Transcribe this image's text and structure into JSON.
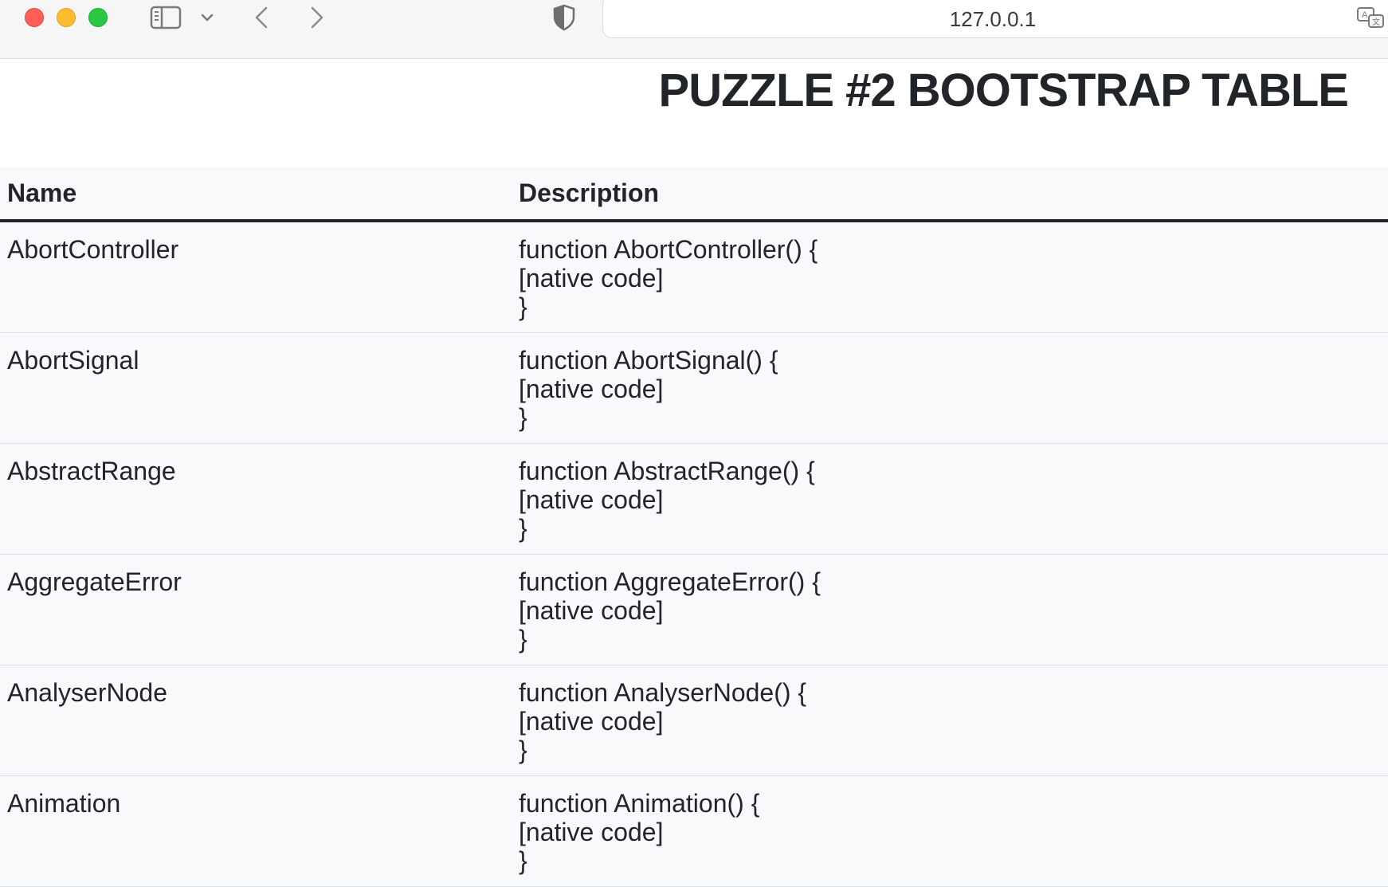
{
  "browser": {
    "address": "127.0.0.1"
  },
  "page": {
    "title": "PUZZLE #2 BOOTSTRAP TABLE"
  },
  "table": {
    "headers": [
      "Name",
      "Description"
    ],
    "rows": [
      {
        "name": "AbortController",
        "desc": [
          "function AbortController() {",
          "[native code]",
          "}"
        ]
      },
      {
        "name": "AbortSignal",
        "desc": [
          "function AbortSignal() {",
          "[native code]",
          "}"
        ]
      },
      {
        "name": "AbstractRange",
        "desc": [
          "function AbstractRange() {",
          "[native code]",
          "}"
        ]
      },
      {
        "name": "AggregateError",
        "desc": [
          "function AggregateError() {",
          "[native code]",
          "}"
        ]
      },
      {
        "name": "AnalyserNode",
        "desc": [
          "function AnalyserNode() {",
          "[native code]",
          "}"
        ]
      },
      {
        "name": "Animation",
        "desc": [
          "function Animation() {",
          "[native code]",
          "}"
        ]
      }
    ]
  },
  "icons": {
    "close": "close-window-icon",
    "minimize": "minimize-window-icon",
    "zoom": "zoom-window-icon",
    "sidebar": "sidebar-icon",
    "tab_group": "chevron-down-icon",
    "back": "chevron-left-icon",
    "forward": "chevron-right-icon",
    "privacy": "shield-icon",
    "translate": "translate-icon"
  },
  "colors": {
    "close": "#ff5f57",
    "minimize": "#febc2e",
    "zoom": "#28c840",
    "table_bg": "#f8f9fa",
    "text": "#212529"
  }
}
